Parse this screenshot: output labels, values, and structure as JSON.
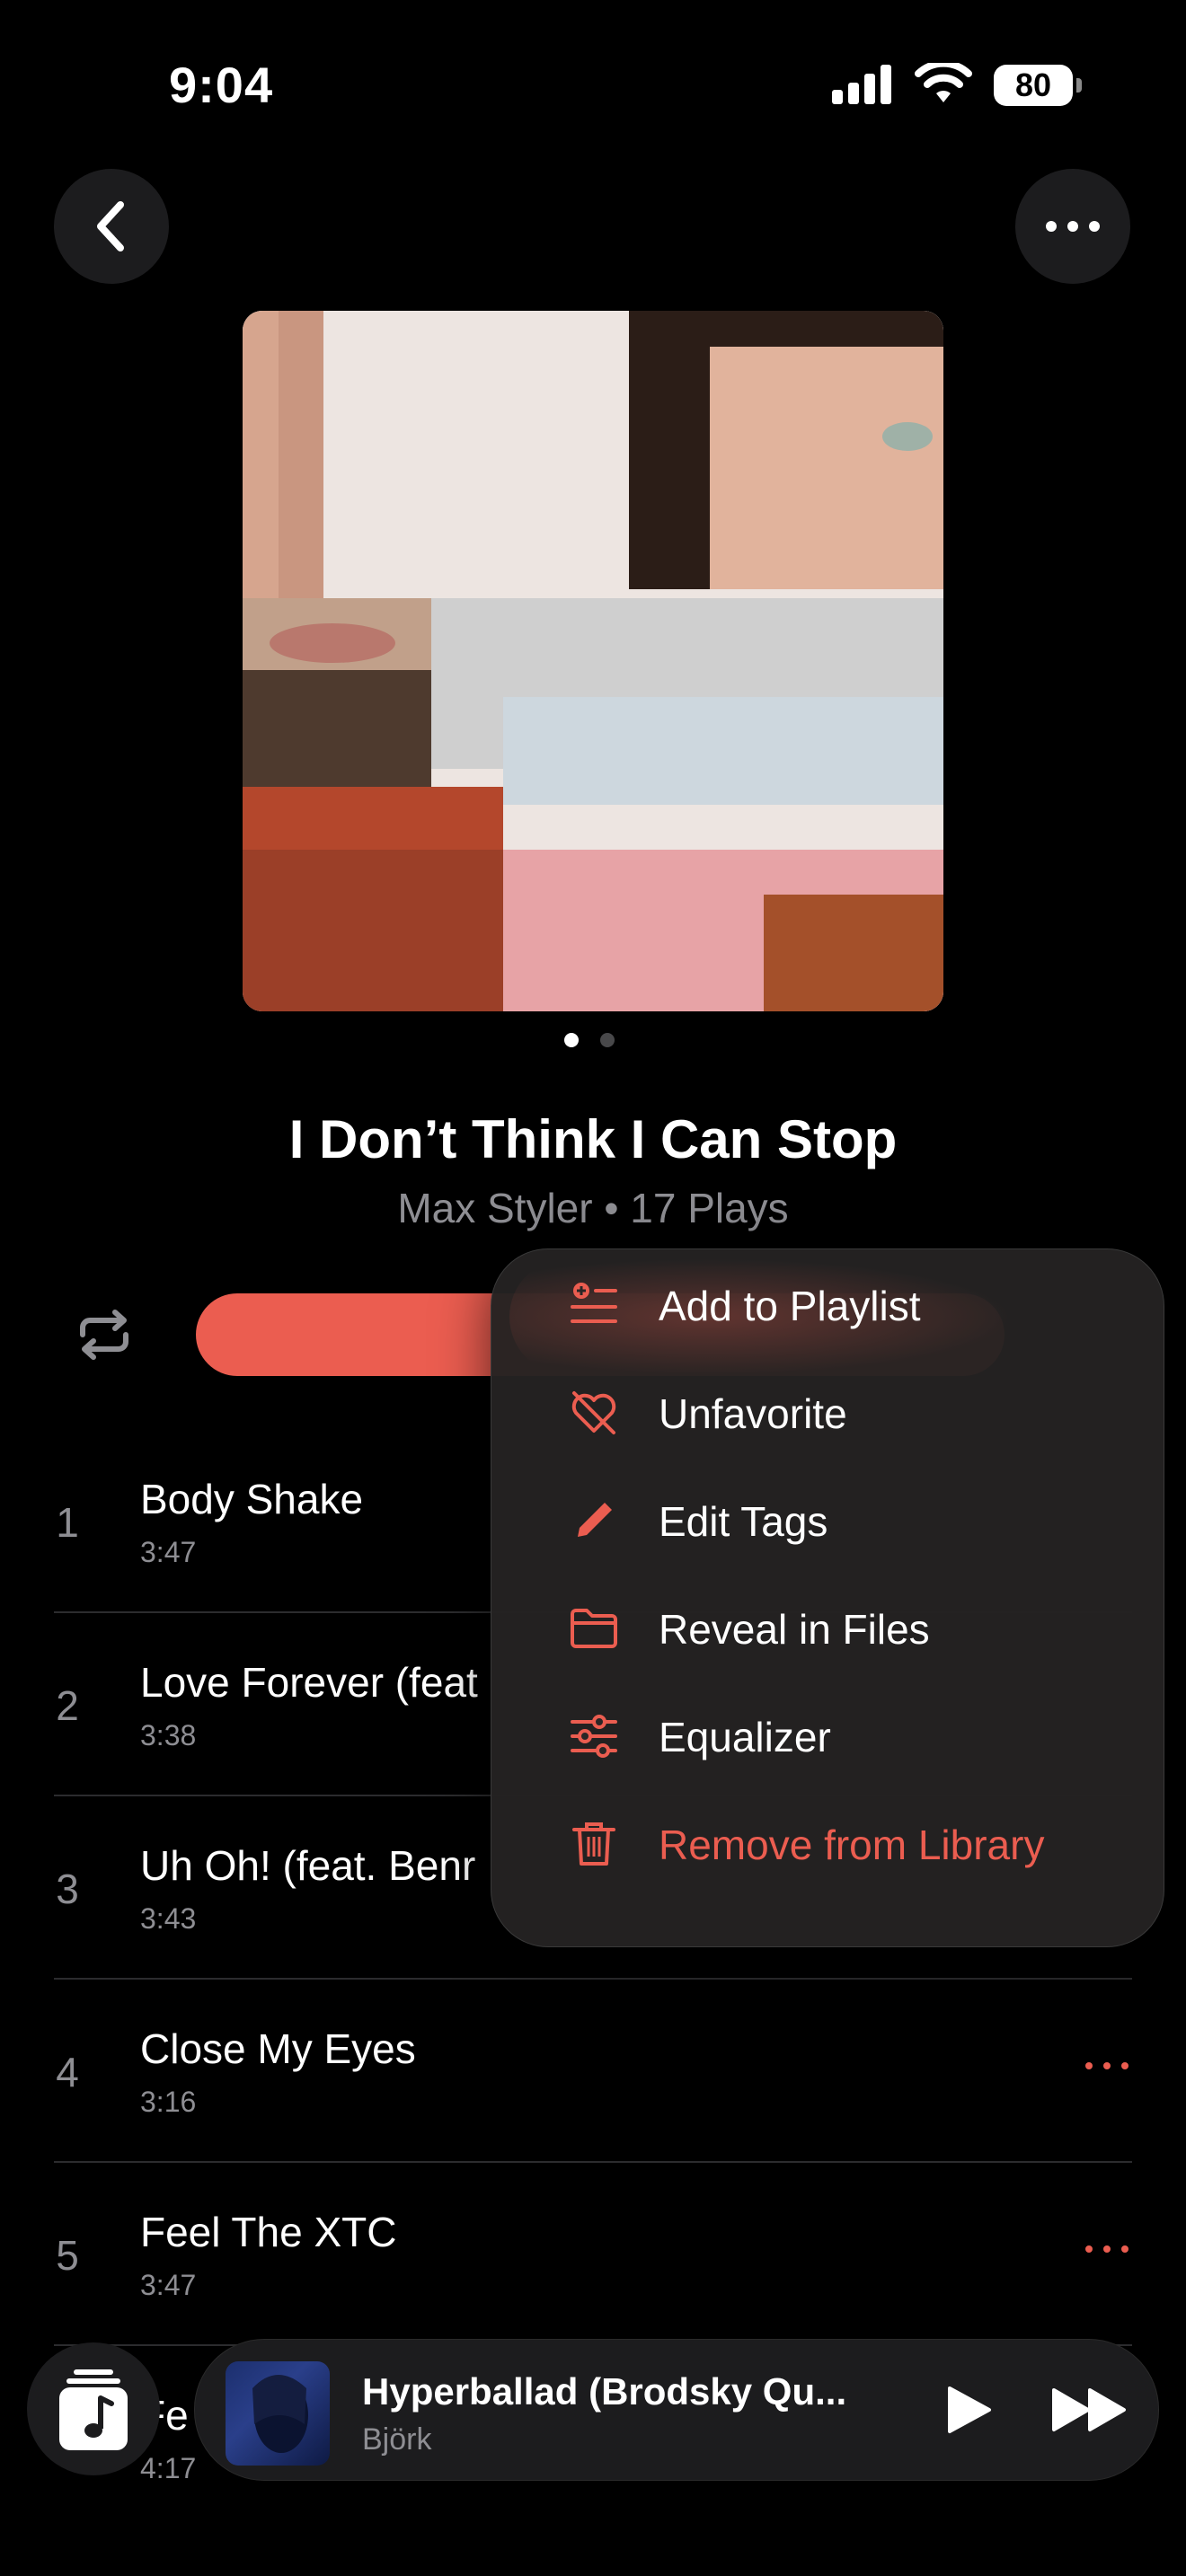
{
  "status_bar": {
    "time": "9:04",
    "battery": "80"
  },
  "header": {
    "back_icon": "chevron-left-icon",
    "more_icon": "ellipsis-icon"
  },
  "album": {
    "title": "I Don’t Think I Can Stop",
    "subtitle": "Max Styler • 17 Plays",
    "page_count": 2,
    "current_page": 1
  },
  "controls": {
    "repeat_icon": "repeat-icon",
    "accent": "#eb5d50"
  },
  "tracks": [
    {
      "number": "1",
      "name": "Body Shake",
      "duration": "3:47"
    },
    {
      "number": "2",
      "name": "Love Forever (feat",
      "duration": "3:38"
    },
    {
      "number": "3",
      "name": "Uh Oh! (feat. Benr",
      "duration": "3:43"
    },
    {
      "number": "4",
      "name": "Close My Eyes",
      "duration": "3:16"
    },
    {
      "number": "5",
      "name": "Feel The XTC",
      "duration": "3:47"
    },
    {
      "number": "",
      "name": "Fe",
      "duration": "4:17"
    }
  ],
  "context_menu": {
    "items": [
      {
        "label": "Add to Playlist",
        "icon": "add-to-playlist-icon"
      },
      {
        "label": "Unfavorite",
        "icon": "heart-slash-icon"
      },
      {
        "label": "Edit Tags",
        "icon": "pencil-icon"
      },
      {
        "label": "Reveal in Files",
        "icon": "folder-icon"
      },
      {
        "label": "Equalizer",
        "icon": "sliders-icon"
      },
      {
        "label": "Remove from Library",
        "icon": "trash-icon",
        "destructive": true
      }
    ]
  },
  "mini_player": {
    "title": "Hyperballad (Brodsky Qu...",
    "artist": "Björk",
    "play_icon": "play-icon",
    "next_icon": "forward-icon",
    "library_icon": "music-library-icon"
  }
}
